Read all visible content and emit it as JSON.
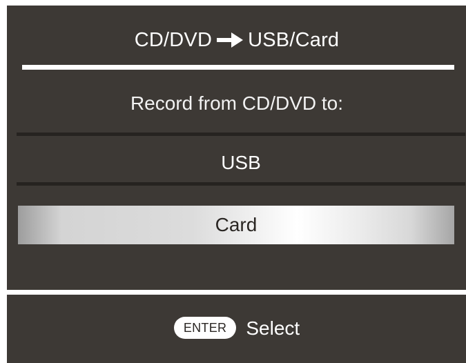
{
  "header": {
    "source": "CD/DVD",
    "arrow_icon": "right-arrow-icon",
    "destination": "USB/Card"
  },
  "prompt": "Record from CD/DVD to:",
  "options": [
    {
      "label": "USB",
      "selected": false
    },
    {
      "label": "Card",
      "selected": true
    }
  ],
  "footer": {
    "key_label": "ENTER",
    "action_label": "Select"
  },
  "colors": {
    "background": "#3d3935",
    "text": "#ffffff",
    "highlight": "#e6e6e6"
  }
}
